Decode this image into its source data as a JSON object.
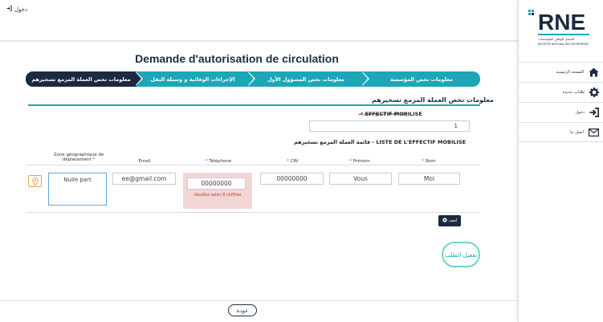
{
  "topbar": {
    "login_label": "دخول"
  },
  "page": {
    "title": "Demande d'autorisation de circulation"
  },
  "steps": [
    {
      "label": "معلومات تخص المؤسسة"
    },
    {
      "label": "معلومات تخص المسؤول الأول"
    },
    {
      "label": "الإجراءات الوقائية و وسيلة النقل"
    },
    {
      "label": "معلومات تخص العملة المزمع تسخيرهم"
    }
  ],
  "section": {
    "title": "معلومات تخص العملة المزمع تسخيرهم"
  },
  "effectif": {
    "label_ar": "عدد العملة المزمع تسخيرهم -",
    "label_fr": "EFFECTIF MOBILISE",
    "required": "*",
    "value": "1"
  },
  "list": {
    "title": "قائمة العملة المزمع تسخيرهم - LISTE DE L'EFFECTIF MOBILISE"
  },
  "columns": {
    "zone": "Zone géographique de déplacement",
    "email": "Email",
    "telephone": "Téléphone",
    "cin": "CIN",
    "prenom": "Prénom",
    "nom": "Nom"
  },
  "row": {
    "zone": "Nulle part",
    "email": "ee@gmail.com",
    "telephone": "00000000",
    "telephone_error": "Veuillez saisir 8 chiffres",
    "cin": "00000000",
    "prenom": "Vous",
    "nom": "Moi"
  },
  "buttons": {
    "add": "أضف",
    "activate": "تفعيل الطلب",
    "back": "عودة"
  },
  "sidebar": {
    "items": [
      {
        "label": "الصفحة الرئيسية",
        "icon": "home-icon"
      },
      {
        "label": "طلبات جديدة",
        "icon": "gear-icon"
      },
      {
        "label": "دخول",
        "icon": "login-icon"
      },
      {
        "label": "اتصل بنا",
        "icon": "mail-icon"
      }
    ]
  },
  "logo": {
    "text": "RNE",
    "subtitle": "REGISTRE NATIONAL DES ENTREPRISES",
    "brand_color": "#1ba7b8"
  }
}
